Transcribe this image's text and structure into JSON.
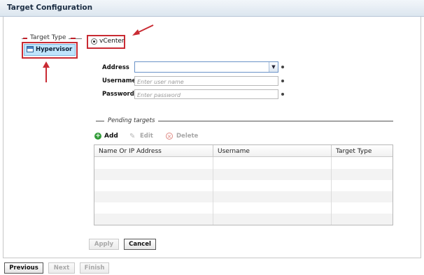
{
  "header": {
    "title": "Target Configuration"
  },
  "target_type": {
    "legend": "Target Type",
    "hypervisor_label": "Hypervisor",
    "vcenter_label": "vCenter",
    "vcenter_selected": true
  },
  "form": {
    "address_label": "Address",
    "address_value": "",
    "username_label": "Username",
    "username_placeholder": "Enter user name",
    "password_label": "Password",
    "password_placeholder": "Enter password"
  },
  "pending": {
    "legend": "Pending targets",
    "add_label": "Add",
    "edit_label": "Edit",
    "delete_label": "Delete",
    "columns": [
      "Name Or IP Address",
      "Username",
      "Target Type"
    ],
    "rows": []
  },
  "actions": {
    "apply_label": "Apply",
    "cancel_label": "Cancel"
  },
  "nav": {
    "previous_label": "Previous",
    "next_label": "Next",
    "finish_label": "Finish"
  },
  "colors": {
    "annotation_red": "#c92b33",
    "selected_blue": "#bfe4fb",
    "add_green": "#2f9a36"
  },
  "icons": [
    "hypervisor-icon",
    "radio-icon",
    "dropdown-arrow-icon",
    "add-icon",
    "edit-icon",
    "delete-icon",
    "red-arrow-annotation"
  ]
}
